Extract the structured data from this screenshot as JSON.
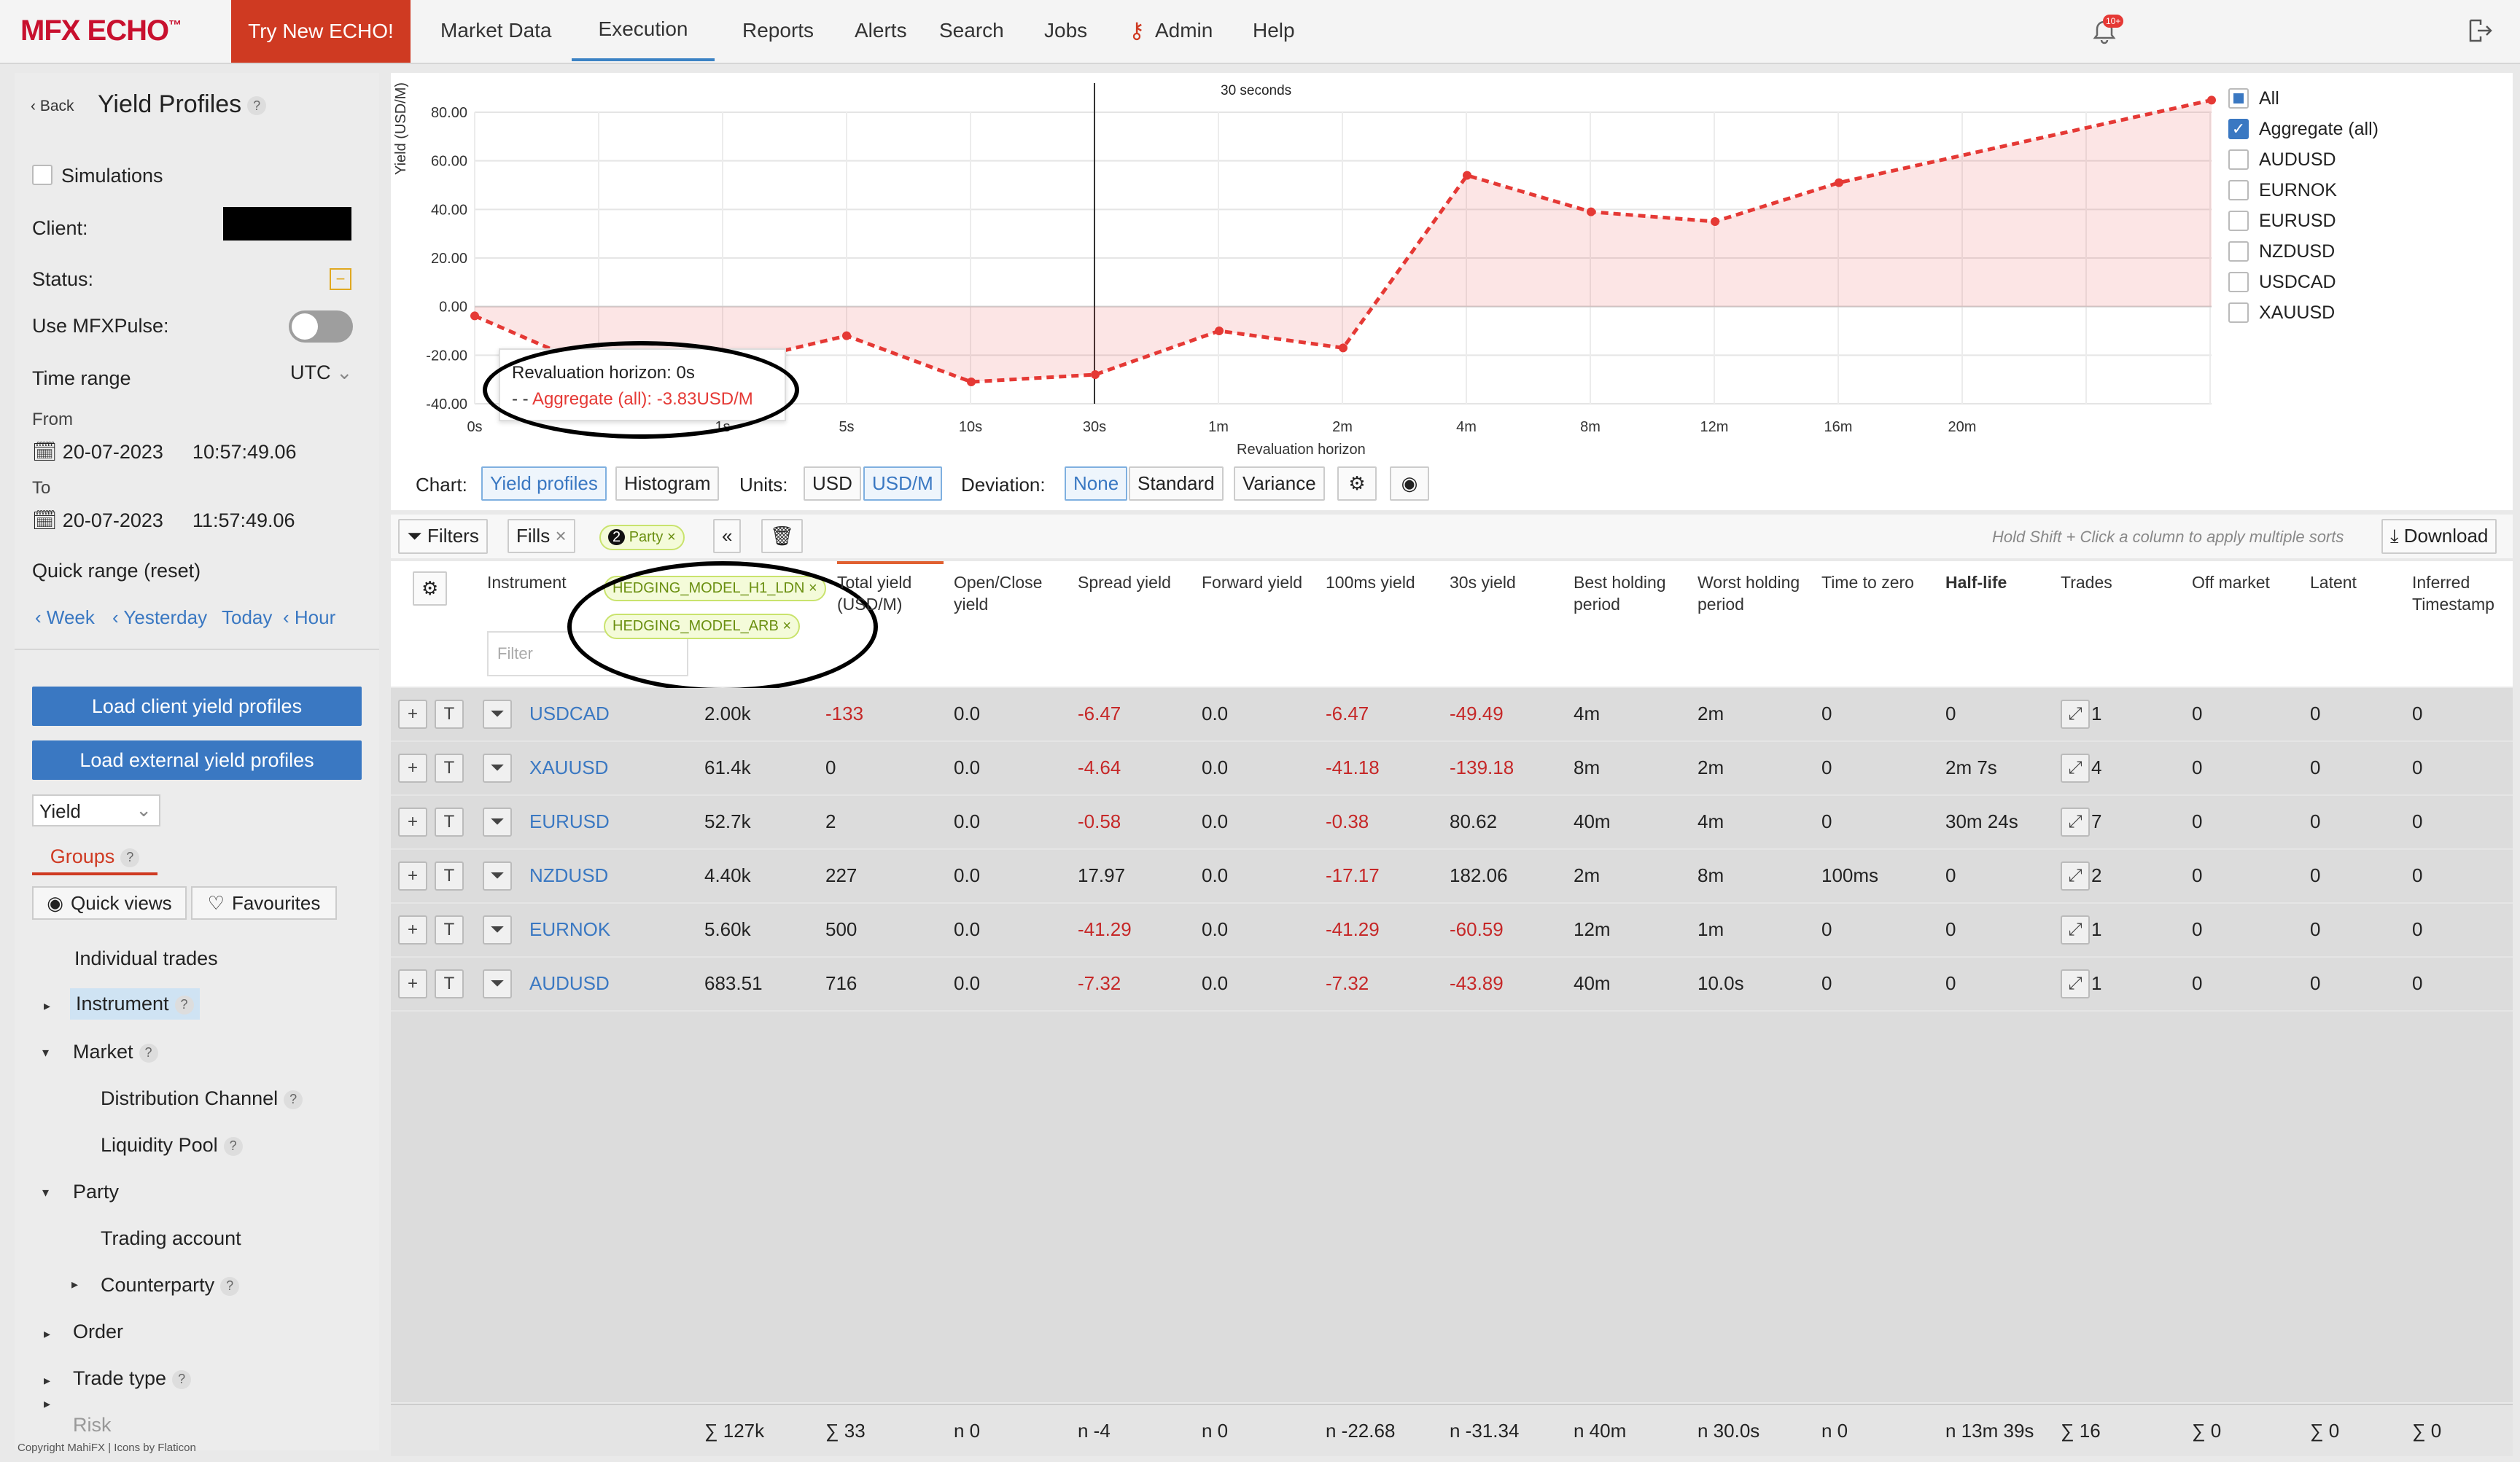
{
  "nav": {
    "logo": "MFX ECHO",
    "logo_tm": "™",
    "try": "Try New ECHO!",
    "items": [
      "Market Data",
      "Execution",
      "Reports",
      "Alerts",
      "Search",
      "Jobs",
      "Admin",
      "Help"
    ],
    "notif_badge": "10+"
  },
  "sidebar": {
    "back": "Back",
    "title": "Yield Profiles",
    "simulations": "Simulations",
    "client_label": "Client:",
    "status_label": "Status:",
    "pulse_label": "Use MFXPulse:",
    "time_range_label": "Time range",
    "tz": "UTC",
    "from_label": "From",
    "from_date": "20-07-2023",
    "from_time": "10:57:49.06",
    "to_label": "To",
    "to_date": "20-07-2023",
    "to_time": "11:57:49.06",
    "quick_range": "Quick range (reset)",
    "quick_week": "Week",
    "quick_yesterday": "Yesterday",
    "quick_today": "Today",
    "quick_hour": "Hour",
    "load_client": "Load client yield profiles",
    "load_external": "Load external yield profiles",
    "yield_select": "Yield",
    "groups_tab": "Groups",
    "quick_views": "Quick views",
    "favourites": "Favourites",
    "tree": {
      "individual": "Individual trades",
      "instrument": "Instrument",
      "market": "Market",
      "distribution": "Distribution Channel",
      "liquidity": "Liquidity Pool",
      "party": "Party",
      "trading_account": "Trading account",
      "counterparty": "Counterparty",
      "order": "Order",
      "trade_type": "Trade type",
      "risk": "Risk"
    },
    "copyright": "Copyright MahiFX | Icons by Flaticon"
  },
  "chart_data": {
    "type": "line",
    "x": [
      "0s",
      "1s",
      "5s",
      "10s",
      "30s",
      "1m",
      "2m",
      "4m",
      "8m",
      "12m",
      "16m",
      "20m"
    ],
    "series": [
      {
        "name": "Aggregate (all)",
        "values": [
          -3.83,
          -26,
          -24,
          -12,
          -31,
          -28,
          -10,
          -17,
          54,
          39,
          35,
          51,
          85
        ]
      }
    ],
    "ylabel": "Yield (USD/M)",
    "xlabel": "Revaluation horizon",
    "yticks": [
      "80.00",
      "60.00",
      "40.00",
      "20.00",
      "0.00",
      "-20.00",
      "-40.00"
    ],
    "ylim": [
      -40,
      80
    ],
    "vline_label": "30 seconds",
    "tooltip_title": "Revaluation horizon: 0s",
    "tooltip_value": "Aggregate (all): -3.83USD/M",
    "legend": [
      "All",
      "Aggregate (all)",
      "AUDUSD",
      "EURNOK",
      "EURUSD",
      "NZDUSD",
      "USDCAD",
      "XAUUSD"
    ],
    "legend_checked": [
      false,
      true,
      false,
      false,
      false,
      false,
      false,
      false
    ],
    "color": "#e53935"
  },
  "controls": {
    "chart": "Chart:",
    "yield_profiles": "Yield profiles",
    "histogram": "Histogram",
    "units": "Units:",
    "usd": "USD",
    "usdm": "USD/M",
    "deviation": "Deviation:",
    "none": "None",
    "standard": "Standard",
    "variance": "Variance"
  },
  "filterbar": {
    "filters": "Filters",
    "fills": "Fills",
    "party_count": "2",
    "party": "Party",
    "hint": "Hold Shift + Click a column to apply multiple sorts",
    "download": "Download",
    "tag1": "HEDGING_MODEL_H1_LDN",
    "tag2": "HEDGING_MODEL_ARB",
    "filter_placeholder": "Filter"
  },
  "columns": [
    "Instrument",
    "Total yield (USD/M)",
    "Open/Close yield",
    "Spread yield",
    "Forward yield",
    "100ms yield",
    "30s yield",
    "Best holding period",
    "Worst holding period",
    "Time to zero",
    "Half-life",
    "Trades",
    "Off market",
    "Latent",
    "Inferred Timestamp"
  ],
  "rows": [
    {
      "instrument": "USDCAD",
      "vol": "2.00k",
      "total": "-133",
      "oc": "0.0",
      "spread": "-6.47",
      "fwd": "0.0",
      "ms100": "-6.47",
      "s30": "-49.49",
      "best": "4m",
      "worst": "2m",
      "ttz": "0",
      "half": "0",
      "trades": "1",
      "off": "0",
      "latent": "0",
      "inferred": "0"
    },
    {
      "instrument": "XAUUSD",
      "vol": "61.4k",
      "total": "0",
      "oc": "0.0",
      "spread": "-4.64",
      "fwd": "0.0",
      "ms100": "-41.18",
      "s30": "-139.18",
      "best": "8m",
      "worst": "2m",
      "ttz": "0",
      "half": "2m 7s",
      "trades": "4",
      "off": "0",
      "latent": "0",
      "inferred": "0"
    },
    {
      "instrument": "EURUSD",
      "vol": "52.7k",
      "total": "2",
      "oc": "0.0",
      "spread": "-0.58",
      "fwd": "0.0",
      "ms100": "-0.38",
      "s30": "80.62",
      "best": "40m",
      "worst": "4m",
      "ttz": "0",
      "half": "30m 24s",
      "trades": "7",
      "off": "0",
      "latent": "0",
      "inferred": "0"
    },
    {
      "instrument": "NZDUSD",
      "vol": "4.40k",
      "total": "227",
      "oc": "0.0",
      "spread": "17.97",
      "fwd": "0.0",
      "ms100": "-17.17",
      "s30": "182.06",
      "best": "2m",
      "worst": "8m",
      "ttz": "100ms",
      "half": "0",
      "trades": "2",
      "off": "0",
      "latent": "0",
      "inferred": "0"
    },
    {
      "instrument": "EURNOK",
      "vol": "5.60k",
      "total": "500",
      "oc": "0.0",
      "spread": "-41.29",
      "fwd": "0.0",
      "ms100": "-41.29",
      "s30": "-60.59",
      "best": "12m",
      "worst": "1m",
      "ttz": "0",
      "half": "0",
      "trades": "1",
      "off": "0",
      "latent": "0",
      "inferred": "0"
    },
    {
      "instrument": "AUDUSD",
      "vol": "683.51",
      "total": "716",
      "oc": "0.0",
      "spread": "-7.32",
      "fwd": "0.0",
      "ms100": "-7.32",
      "s30": "-43.89",
      "best": "40m",
      "worst": "10.0s",
      "ttz": "0",
      "half": "0",
      "trades": "1",
      "off": "0",
      "latent": "0",
      "inferred": "0"
    }
  ],
  "footer": {
    "vol": "∑ 127k",
    "total": "∑ 33",
    "oc": "n 0",
    "spread": "n -4",
    "fwd": "n 0",
    "ms100": "n -22.68",
    "s30": "n -31.34",
    "best": "n 40m",
    "worst": "n 30.0s",
    "ttz": "n 0",
    "half": "n 13m 39s",
    "trades": "∑ 16",
    "off": "∑ 0",
    "latent": "∑ 0",
    "inferred": "∑ 0"
  }
}
